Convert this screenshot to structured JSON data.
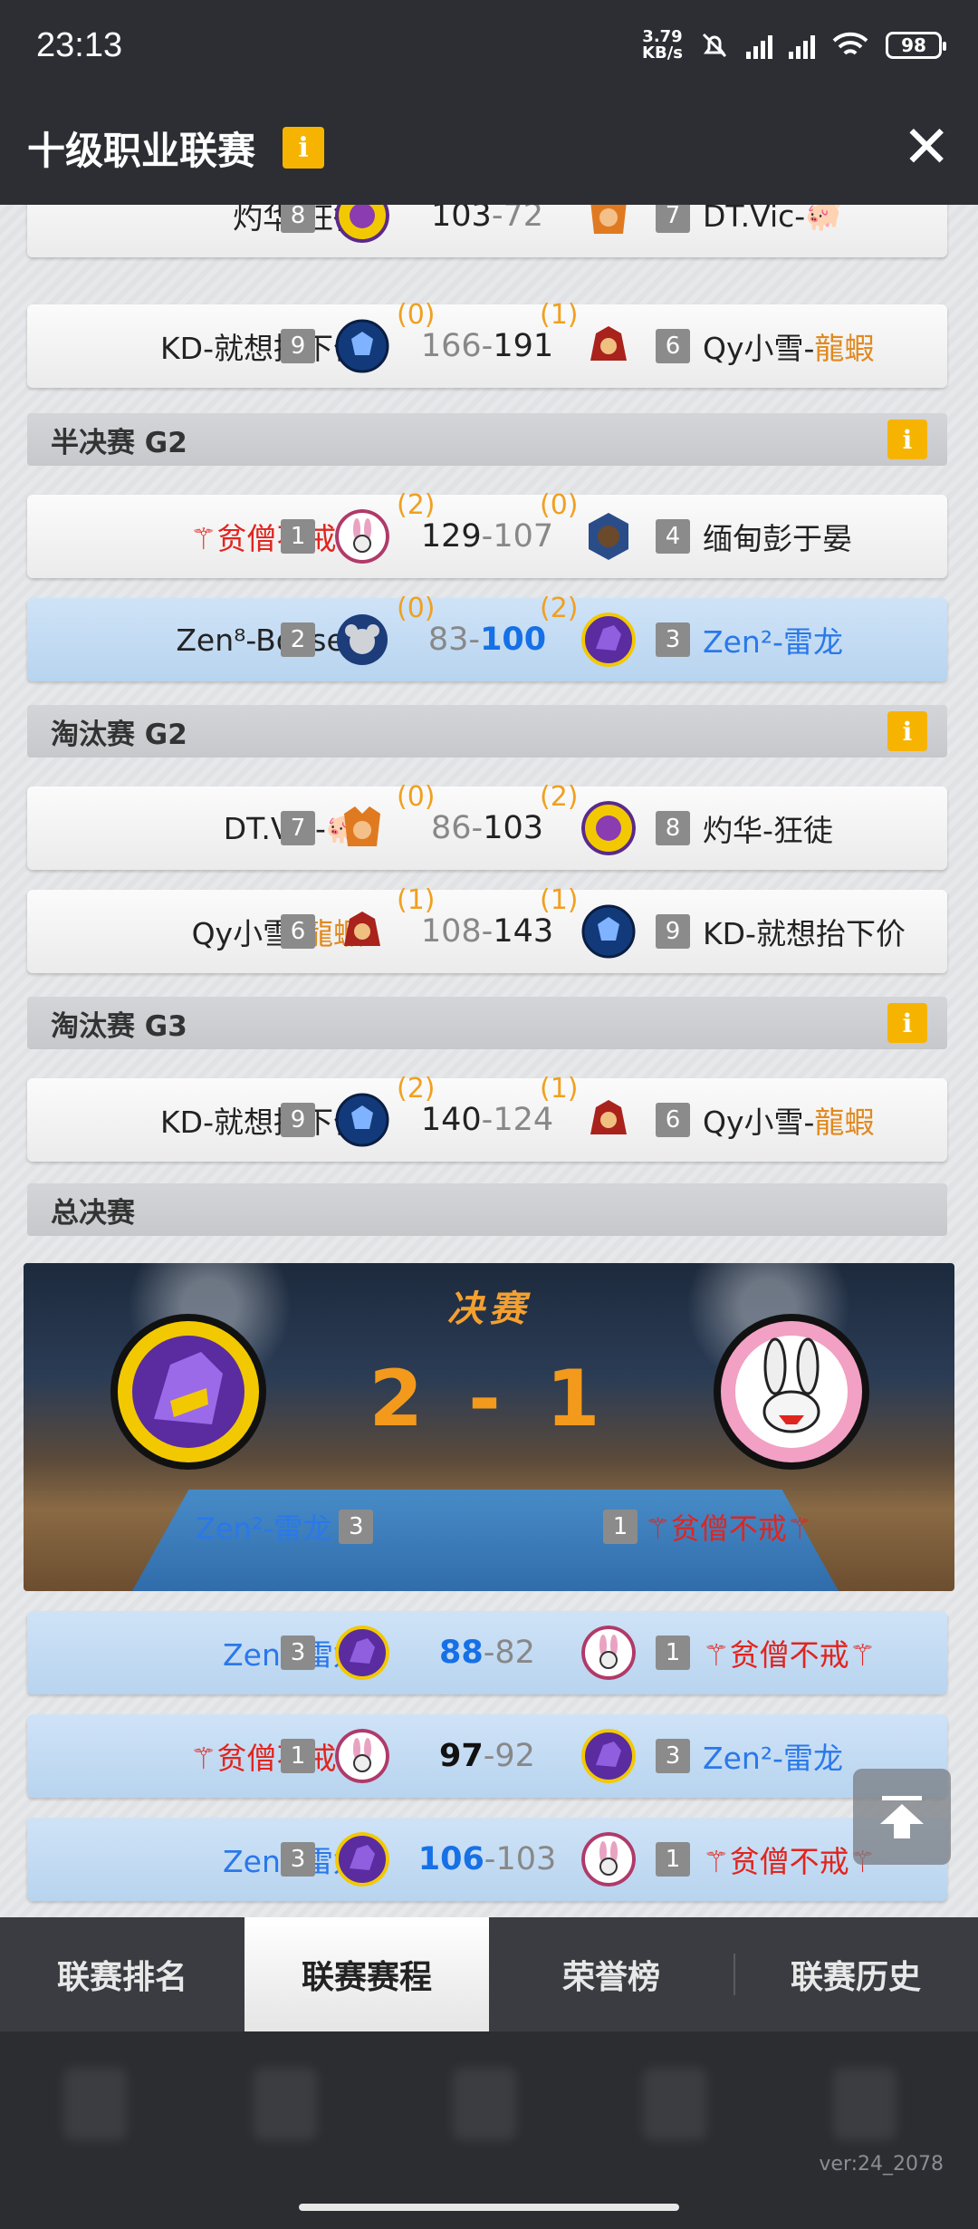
{
  "status": {
    "time": "23:13",
    "net_speed_value": "3.79",
    "net_speed_unit": "KB/s",
    "battery": "98"
  },
  "header": {
    "title": "十级职业联赛",
    "info_label": "i"
  },
  "teams": {
    "zhuohua": {
      "name": "灼华-狂徒",
      "seed": "8"
    },
    "dtvic": {
      "name": "DT.Vic-",
      "emoji": "🐖",
      "seed": "7"
    },
    "kd": {
      "name": "KD-就想抬下价",
      "seed": "9"
    },
    "qy": {
      "prefix": "Qy小雪-",
      "suffix": "龍蝦",
      "seed": "6"
    },
    "pinseng": {
      "name": "⚚贫僧不戒⚚",
      "seed": "1"
    },
    "miandian": {
      "name": "缅甸彭于晏",
      "seed": "4"
    },
    "zen8": {
      "name": "Zen⁸-Boilsea",
      "seed": "2"
    },
    "zen2": {
      "name": "Zen²-雷龙",
      "seed": "3"
    }
  },
  "matches": [
    {
      "left_score": "103",
      "right_score": "72"
    },
    {
      "left_sub": "(0)",
      "right_sub": "(1)",
      "left_score": "166",
      "right_score": "191"
    },
    {
      "left_sub": "(2)",
      "right_sub": "(0)",
      "left_score": "129",
      "right_score": "107"
    },
    {
      "left_sub": "(0)",
      "right_sub": "(2)",
      "left_score": "83",
      "right_score": "100"
    },
    {
      "left_sub": "(0)",
      "right_sub": "(2)",
      "left_score": "86",
      "right_score": "103"
    },
    {
      "left_sub": "(1)",
      "right_sub": "(1)",
      "left_score": "108",
      "right_score": "143"
    },
    {
      "left_sub": "(2)",
      "right_sub": "(1)",
      "left_score": "140",
      "right_score": "124"
    },
    {
      "left_score": "88",
      "right_score": "82"
    },
    {
      "left_score": "97",
      "right_score": "92"
    },
    {
      "left_score": "106",
      "right_score": "103"
    }
  ],
  "sections": {
    "semifinal_g2": "半决赛 G2",
    "elim_g2": "淘汰赛 G2",
    "elim_g3": "淘汰赛 G3",
    "grand_final": "总决赛"
  },
  "final": {
    "title": "决赛",
    "score": "2 - 1"
  },
  "score_sep": "-",
  "tabs": [
    "联赛排名",
    "联赛赛程",
    "荣誉榜",
    "联赛历史"
  ],
  "version": "ver:24_2078",
  "colors": {
    "accent_orange": "#f6b400",
    "win_blue": "#1670e6",
    "red_team": "#e0251f"
  }
}
